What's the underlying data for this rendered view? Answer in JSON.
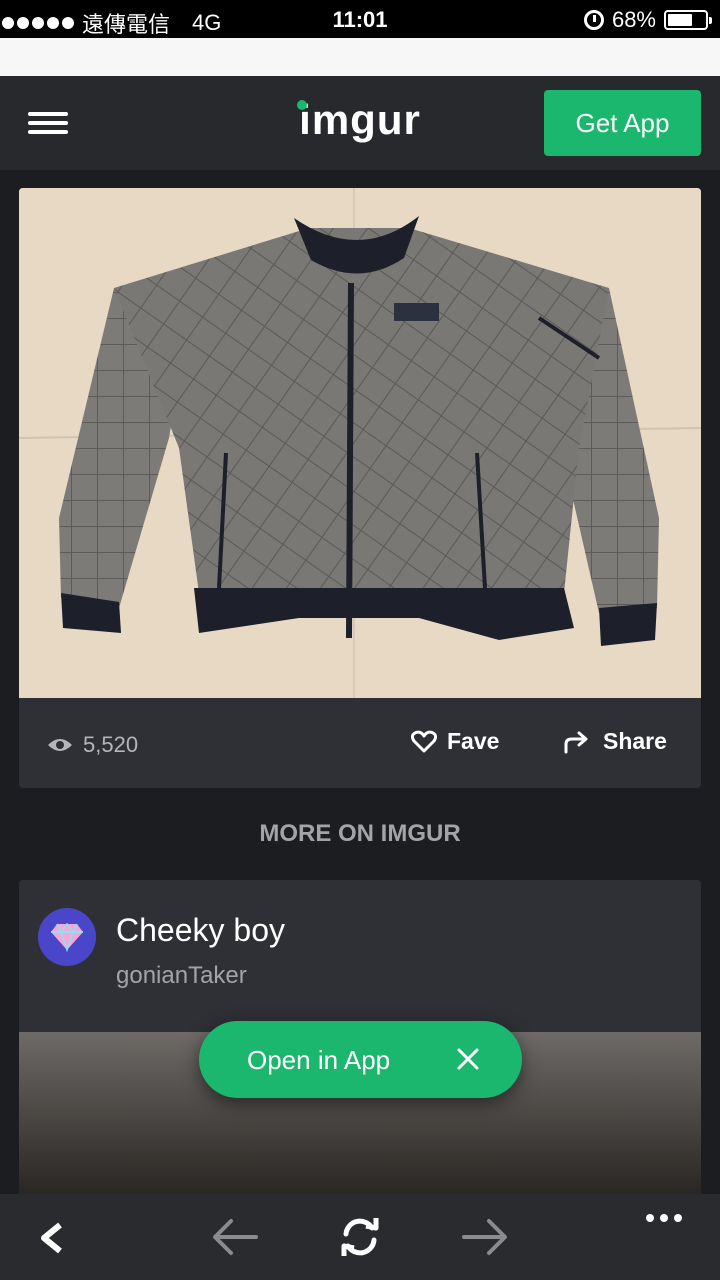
{
  "status_bar": {
    "carrier": "遠傳電信",
    "network": "4G",
    "time": "11:01",
    "battery": "68%",
    "battery_level": 0.68
  },
  "header": {
    "logo": "imgur",
    "get_app_label": "Get App",
    "menu_icon": "hamburger-menu-icon"
  },
  "post": {
    "image_subject": "quilted gray bomber jacket",
    "views": "5,520",
    "fave_label": "Fave",
    "share_label": "Share"
  },
  "more_section": {
    "title": "MORE ON IMGUR"
  },
  "related_post": {
    "title": "Cheeky boy",
    "username": "gonianTaker",
    "avatar_icon": "diamond-icon"
  },
  "open_in_app": {
    "label": "Open in App"
  },
  "toolbar": {
    "items": [
      "chevron-left-icon",
      "back-arrow-icon",
      "reload-icon",
      "forward-arrow-icon",
      "more-dots-icon"
    ]
  },
  "colors": {
    "accent": "#1bb76e",
    "header_bg": "#27292d",
    "page_bg": "#1c1d21",
    "card_bg": "#2e3035",
    "avatar_bg": "#4a46c9"
  }
}
